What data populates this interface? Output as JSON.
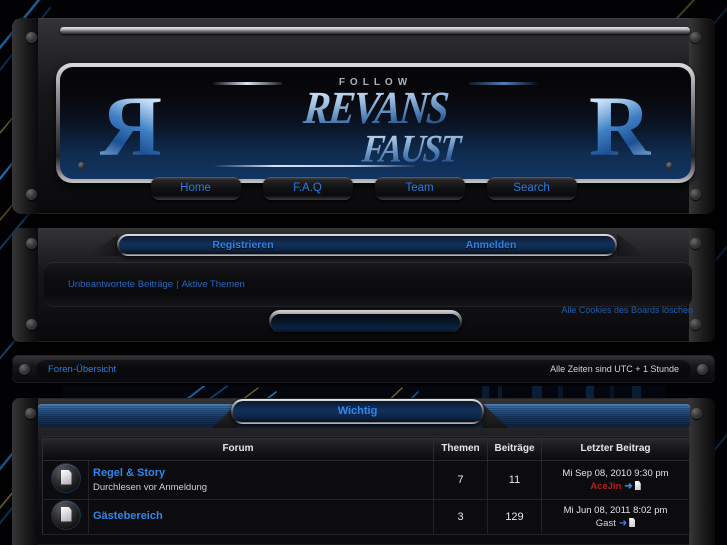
{
  "site": {
    "logo_follow": "FOLLOW",
    "logo_main": "REVANS",
    "logo_sub": "FAUST",
    "side_letter": "R"
  },
  "nav": {
    "items": [
      {
        "label": "Home",
        "name": "nav-home"
      },
      {
        "label": "F.A.Q",
        "name": "nav-faq"
      },
      {
        "label": "Team",
        "name": "nav-team"
      },
      {
        "label": "Search",
        "name": "nav-search"
      }
    ]
  },
  "auth": {
    "register_label": "Registrieren",
    "login_label": "Anmelden"
  },
  "quicklinks": {
    "unanswered": "Unbeantwortete Beiträge",
    "separator": "|",
    "active_topics": "Aktive Themen"
  },
  "search": {
    "value": "",
    "placeholder": ""
  },
  "cookies": {
    "label": "Alle Cookies des Boards löschen"
  },
  "breadcrumb": {
    "home": "Foren-Übersicht",
    "timezone": "Alle Zeiten sind UTC + 1 Stunde"
  },
  "category": {
    "title": "Wichtig",
    "columns": {
      "forum": "Forum",
      "topics": "Themen",
      "posts": "Beiträge",
      "lastpost": "Letzter Beitrag"
    },
    "rows": [
      {
        "icon": "folder-icon",
        "title": "Regel & Story",
        "description": "Durchlesen vor Anmeldung",
        "topics": "7",
        "posts": "11",
        "last_date": "Mi Sep 08, 2010 9:30 pm",
        "last_user": "AceJin",
        "last_user_color": "#b02020"
      },
      {
        "icon": "folder-icon",
        "title": "Gästebereich",
        "description": "",
        "topics": "3",
        "posts": "129",
        "last_date": "Mi Jun 08, 2011 8:02 pm",
        "last_user": "Gast",
        "last_user_color": "#d8d8dc"
      }
    ]
  },
  "theme": {
    "accent_blue": "#2f86ee",
    "link_blue": "#2668c0",
    "panel_black": "#0b0b0d",
    "metal_gray": "#2b2b2e"
  }
}
